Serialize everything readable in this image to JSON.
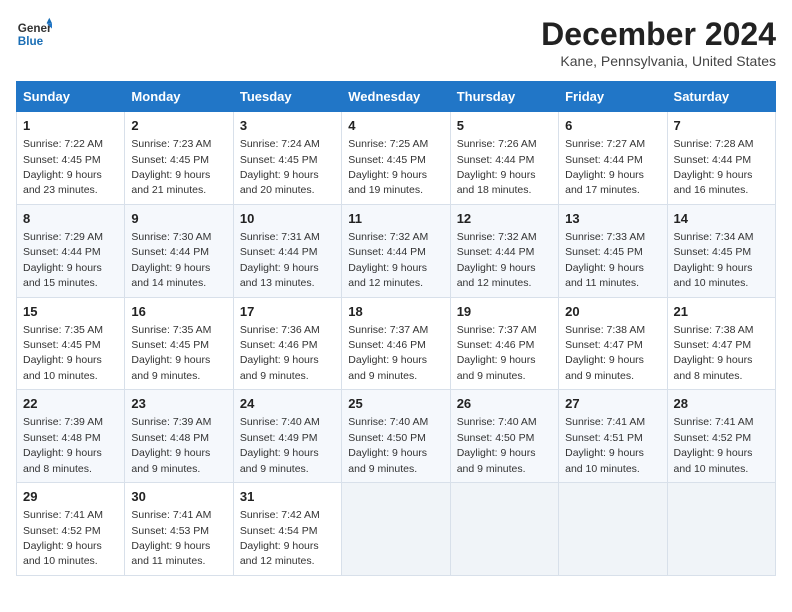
{
  "header": {
    "logo_line1": "General",
    "logo_line2": "Blue",
    "title": "December 2024",
    "subtitle": "Kane, Pennsylvania, United States"
  },
  "days_of_week": [
    "Sunday",
    "Monday",
    "Tuesday",
    "Wednesday",
    "Thursday",
    "Friday",
    "Saturday"
  ],
  "weeks": [
    [
      {
        "day": "1",
        "rise": "Sunrise: 7:22 AM",
        "set": "Sunset: 4:45 PM",
        "daylight": "Daylight: 9 hours and 23 minutes."
      },
      {
        "day": "2",
        "rise": "Sunrise: 7:23 AM",
        "set": "Sunset: 4:45 PM",
        "daylight": "Daylight: 9 hours and 21 minutes."
      },
      {
        "day": "3",
        "rise": "Sunrise: 7:24 AM",
        "set": "Sunset: 4:45 PM",
        "daylight": "Daylight: 9 hours and 20 minutes."
      },
      {
        "day": "4",
        "rise": "Sunrise: 7:25 AM",
        "set": "Sunset: 4:45 PM",
        "daylight": "Daylight: 9 hours and 19 minutes."
      },
      {
        "day": "5",
        "rise": "Sunrise: 7:26 AM",
        "set": "Sunset: 4:44 PM",
        "daylight": "Daylight: 9 hours and 18 minutes."
      },
      {
        "day": "6",
        "rise": "Sunrise: 7:27 AM",
        "set": "Sunset: 4:44 PM",
        "daylight": "Daylight: 9 hours and 17 minutes."
      },
      {
        "day": "7",
        "rise": "Sunrise: 7:28 AM",
        "set": "Sunset: 4:44 PM",
        "daylight": "Daylight: 9 hours and 16 minutes."
      }
    ],
    [
      {
        "day": "8",
        "rise": "Sunrise: 7:29 AM",
        "set": "Sunset: 4:44 PM",
        "daylight": "Daylight: 9 hours and 15 minutes."
      },
      {
        "day": "9",
        "rise": "Sunrise: 7:30 AM",
        "set": "Sunset: 4:44 PM",
        "daylight": "Daylight: 9 hours and 14 minutes."
      },
      {
        "day": "10",
        "rise": "Sunrise: 7:31 AM",
        "set": "Sunset: 4:44 PM",
        "daylight": "Daylight: 9 hours and 13 minutes."
      },
      {
        "day": "11",
        "rise": "Sunrise: 7:32 AM",
        "set": "Sunset: 4:44 PM",
        "daylight": "Daylight: 9 hours and 12 minutes."
      },
      {
        "day": "12",
        "rise": "Sunrise: 7:32 AM",
        "set": "Sunset: 4:44 PM",
        "daylight": "Daylight: 9 hours and 12 minutes."
      },
      {
        "day": "13",
        "rise": "Sunrise: 7:33 AM",
        "set": "Sunset: 4:45 PM",
        "daylight": "Daylight: 9 hours and 11 minutes."
      },
      {
        "day": "14",
        "rise": "Sunrise: 7:34 AM",
        "set": "Sunset: 4:45 PM",
        "daylight": "Daylight: 9 hours and 10 minutes."
      }
    ],
    [
      {
        "day": "15",
        "rise": "Sunrise: 7:35 AM",
        "set": "Sunset: 4:45 PM",
        "daylight": "Daylight: 9 hours and 10 minutes."
      },
      {
        "day": "16",
        "rise": "Sunrise: 7:35 AM",
        "set": "Sunset: 4:45 PM",
        "daylight": "Daylight: 9 hours and 9 minutes."
      },
      {
        "day": "17",
        "rise": "Sunrise: 7:36 AM",
        "set": "Sunset: 4:46 PM",
        "daylight": "Daylight: 9 hours and 9 minutes."
      },
      {
        "day": "18",
        "rise": "Sunrise: 7:37 AM",
        "set": "Sunset: 4:46 PM",
        "daylight": "Daylight: 9 hours and 9 minutes."
      },
      {
        "day": "19",
        "rise": "Sunrise: 7:37 AM",
        "set": "Sunset: 4:46 PM",
        "daylight": "Daylight: 9 hours and 9 minutes."
      },
      {
        "day": "20",
        "rise": "Sunrise: 7:38 AM",
        "set": "Sunset: 4:47 PM",
        "daylight": "Daylight: 9 hours and 9 minutes."
      },
      {
        "day": "21",
        "rise": "Sunrise: 7:38 AM",
        "set": "Sunset: 4:47 PM",
        "daylight": "Daylight: 9 hours and 8 minutes."
      }
    ],
    [
      {
        "day": "22",
        "rise": "Sunrise: 7:39 AM",
        "set": "Sunset: 4:48 PM",
        "daylight": "Daylight: 9 hours and 8 minutes."
      },
      {
        "day": "23",
        "rise": "Sunrise: 7:39 AM",
        "set": "Sunset: 4:48 PM",
        "daylight": "Daylight: 9 hours and 9 minutes."
      },
      {
        "day": "24",
        "rise": "Sunrise: 7:40 AM",
        "set": "Sunset: 4:49 PM",
        "daylight": "Daylight: 9 hours and 9 minutes."
      },
      {
        "day": "25",
        "rise": "Sunrise: 7:40 AM",
        "set": "Sunset: 4:50 PM",
        "daylight": "Daylight: 9 hours and 9 minutes."
      },
      {
        "day": "26",
        "rise": "Sunrise: 7:40 AM",
        "set": "Sunset: 4:50 PM",
        "daylight": "Daylight: 9 hours and 9 minutes."
      },
      {
        "day": "27",
        "rise": "Sunrise: 7:41 AM",
        "set": "Sunset: 4:51 PM",
        "daylight": "Daylight: 9 hours and 10 minutes."
      },
      {
        "day": "28",
        "rise": "Sunrise: 7:41 AM",
        "set": "Sunset: 4:52 PM",
        "daylight": "Daylight: 9 hours and 10 minutes."
      }
    ],
    [
      {
        "day": "29",
        "rise": "Sunrise: 7:41 AM",
        "set": "Sunset: 4:52 PM",
        "daylight": "Daylight: 9 hours and 10 minutes."
      },
      {
        "day": "30",
        "rise": "Sunrise: 7:41 AM",
        "set": "Sunset: 4:53 PM",
        "daylight": "Daylight: 9 hours and 11 minutes."
      },
      {
        "day": "31",
        "rise": "Sunrise: 7:42 AM",
        "set": "Sunset: 4:54 PM",
        "daylight": "Daylight: 9 hours and 12 minutes."
      },
      null,
      null,
      null,
      null
    ]
  ]
}
